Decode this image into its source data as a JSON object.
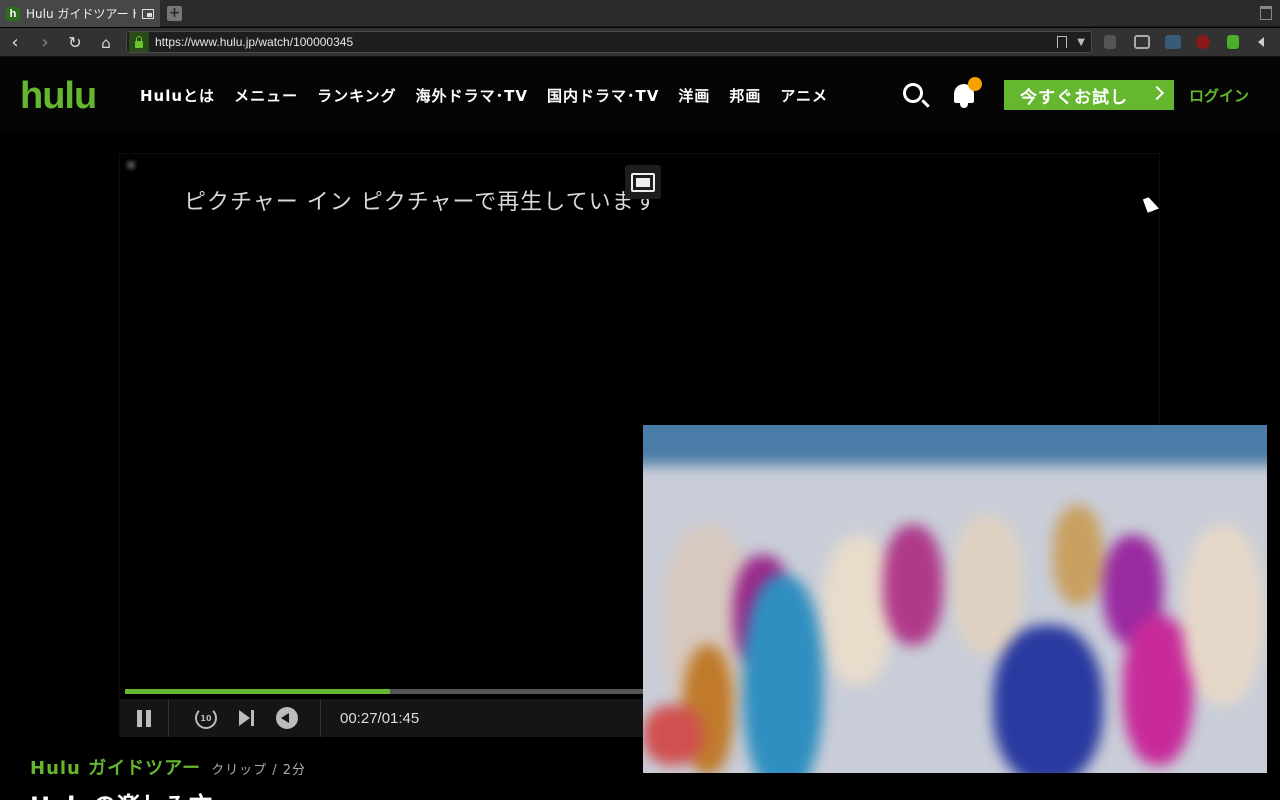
{
  "browser": {
    "tab_title": "Hulu ガイドツアー Hulu",
    "favicon_letter": "h",
    "new_tab_label": "+",
    "url": "https://www.hulu.jp/watch/100000345"
  },
  "header": {
    "logo": "hulu",
    "nav": [
      "Huluとは",
      "メニュー",
      "ランキング",
      "海外ドラマ･TV",
      "国内ドラマ･TV",
      "洋画",
      "邦画",
      "アニメ"
    ],
    "trial_button": "今すぐお試し",
    "login": "ログイン",
    "accent_color": "#64b72e",
    "notification_dot_color": "#f5a000"
  },
  "player": {
    "pip_message": "ピクチャー イン ピクチャーで再生しています",
    "progress": 0.257,
    "time_display": "00:27/01:45",
    "replay_label": "10"
  },
  "content": {
    "series_title": "Hulu ガイドツアー",
    "meta": "クリップ / 2分",
    "episode_title": "Huluの楽しみ方"
  },
  "icons": {
    "back": "back-arrow-icon",
    "forward": "forward-arrow-icon",
    "reload": "reload-icon",
    "home": "home-icon",
    "search": "search-icon",
    "bell": "bell-icon"
  }
}
